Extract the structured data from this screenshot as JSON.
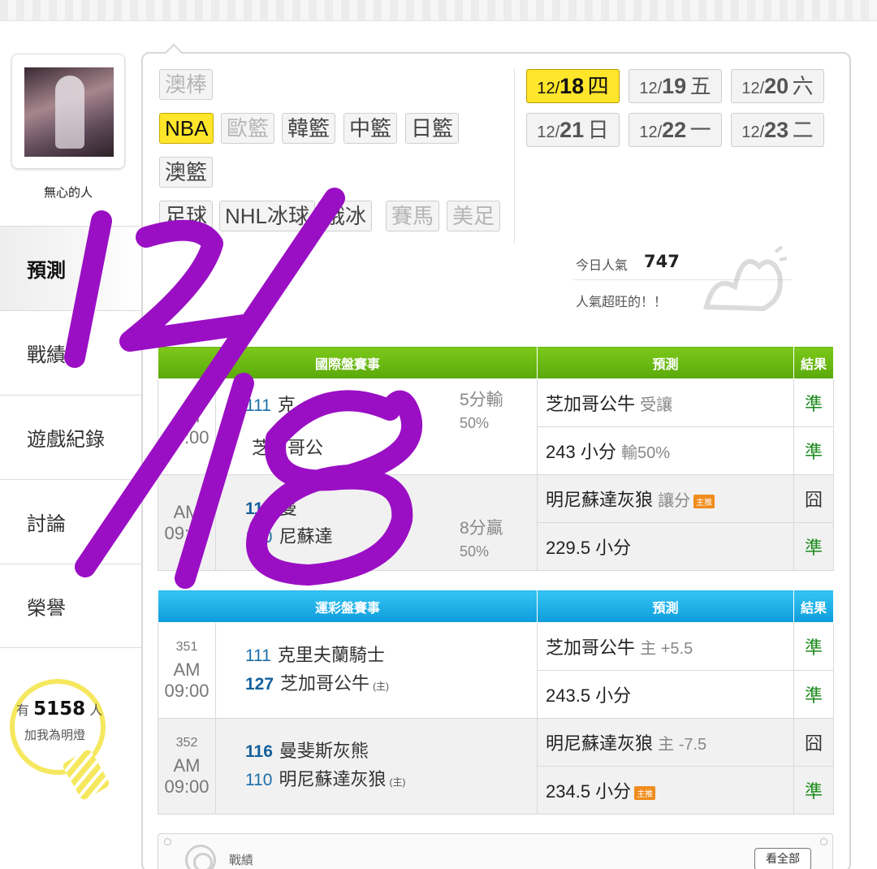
{
  "user": {
    "name": "無心的人"
  },
  "menu": [
    {
      "label": "預測",
      "active": true
    },
    {
      "label": "戰績",
      "active": false
    },
    {
      "label": "遊戲紀錄",
      "active": false
    },
    {
      "label": "討論",
      "active": false
    },
    {
      "label": "榮譽",
      "active": false
    }
  ],
  "bulb": {
    "prefix": "有",
    "count": "5158",
    "suffix": "人",
    "caption": "加我為明燈"
  },
  "sports": {
    "row1": [
      {
        "label": "澳棒",
        "state": "disabled"
      }
    ],
    "row2": [
      {
        "label": "NBA",
        "state": "active"
      },
      {
        "label": "歐籃",
        "state": "disabled"
      },
      {
        "label": "韓籃",
        "state": "normal"
      },
      {
        "label": "中籃",
        "state": "normal"
      },
      {
        "label": "日籃",
        "state": "normal"
      }
    ],
    "row3": [
      {
        "label": "澳籃",
        "state": "normal"
      }
    ],
    "row4": [
      {
        "label": "足球",
        "state": "normal"
      },
      {
        "label": "NHL冰球",
        "state": "normal"
      },
      {
        "label": "俄冰",
        "state": "normal"
      },
      {
        "label": "賽馬",
        "state": "disabled"
      },
      {
        "label": "美足",
        "state": "disabled"
      }
    ]
  },
  "dates": [
    {
      "md": "12/",
      "day": "18",
      "wd": "四",
      "active": true
    },
    {
      "md": "12/",
      "day": "19",
      "wd": "五",
      "active": false
    },
    {
      "md": "12/",
      "day": "20",
      "wd": "六",
      "active": false
    },
    {
      "md": "12/",
      "day": "21",
      "wd": "日",
      "active": false
    },
    {
      "md": "12/",
      "day": "22",
      "wd": "一",
      "active": false
    },
    {
      "md": "12/",
      "day": "23",
      "wd": "二",
      "active": false
    }
  ],
  "popularity": {
    "label": "今日人氣",
    "count": "747",
    "message": "人氣超旺的！！"
  },
  "intl": {
    "header": {
      "event": "國際盤賽事",
      "prediction": "預測",
      "result": "結果"
    },
    "games": [
      {
        "time": "AM 09:00",
        "team1_score": "111",
        "team1_name": "克",
        "team2_score": "",
        "team2_name": "芝加哥公",
        "spread": "5分輸",
        "spread_pct": "50%",
        "predictions": [
          {
            "main": "芝加哥公牛",
            "sub": "受讓",
            "badge": "",
            "result": "準"
          },
          {
            "main": "243 小分",
            "sub": "輸50%",
            "badge": "",
            "result": "準"
          }
        ]
      },
      {
        "time": "AM 09:00",
        "team1_score": "116",
        "team1_name": "曼",
        "team2_score": "110",
        "team2_name": "尼蘇達",
        "spread": "8分贏",
        "spread_pct": "50%",
        "predictions": [
          {
            "main": "明尼蘇達灰狼",
            "sub": "讓分",
            "badge": "主推",
            "result": "囧"
          },
          {
            "main": "229.5 小分",
            "sub": "",
            "badge": "",
            "result": "準"
          }
        ]
      }
    ]
  },
  "sports_lottery": {
    "header": {
      "event": "運彩盤賽事",
      "prediction": "預測",
      "result": "結果"
    },
    "games": [
      {
        "no": "351",
        "time": "AM 09:00",
        "team1_score": "111",
        "team1_name": "克里夫蘭騎士",
        "team2_score": "127",
        "team2_name": "芝加哥公牛",
        "home_mark": "(主)",
        "predictions": [
          {
            "main": "芝加哥公牛",
            "sub": "主 +5.5",
            "badge": "",
            "result": "準"
          },
          {
            "main": "243.5 小分",
            "sub": "",
            "badge": "",
            "result": "準"
          }
        ]
      },
      {
        "no": "352",
        "time": "AM 09:00",
        "team1_score": "116",
        "team1_name": "曼斐斯灰熊",
        "team2_score": "110",
        "team2_name": "明尼蘇達灰狼",
        "home_mark": "(主)",
        "predictions": [
          {
            "main": "明尼蘇達灰狼",
            "sub": "主 -7.5",
            "badge": "",
            "result": "囧"
          },
          {
            "main": "234.5 小分",
            "sub": "",
            "badge": "主推",
            "result": "準"
          }
        ]
      }
    ]
  },
  "record": {
    "title": "戰績",
    "view_all": "看全部"
  },
  "colors": {
    "accent_yellow": "#ffe62a",
    "green_header": "#6cba12",
    "blue_header": "#1aaee6",
    "ink": "#9a0fc4"
  }
}
